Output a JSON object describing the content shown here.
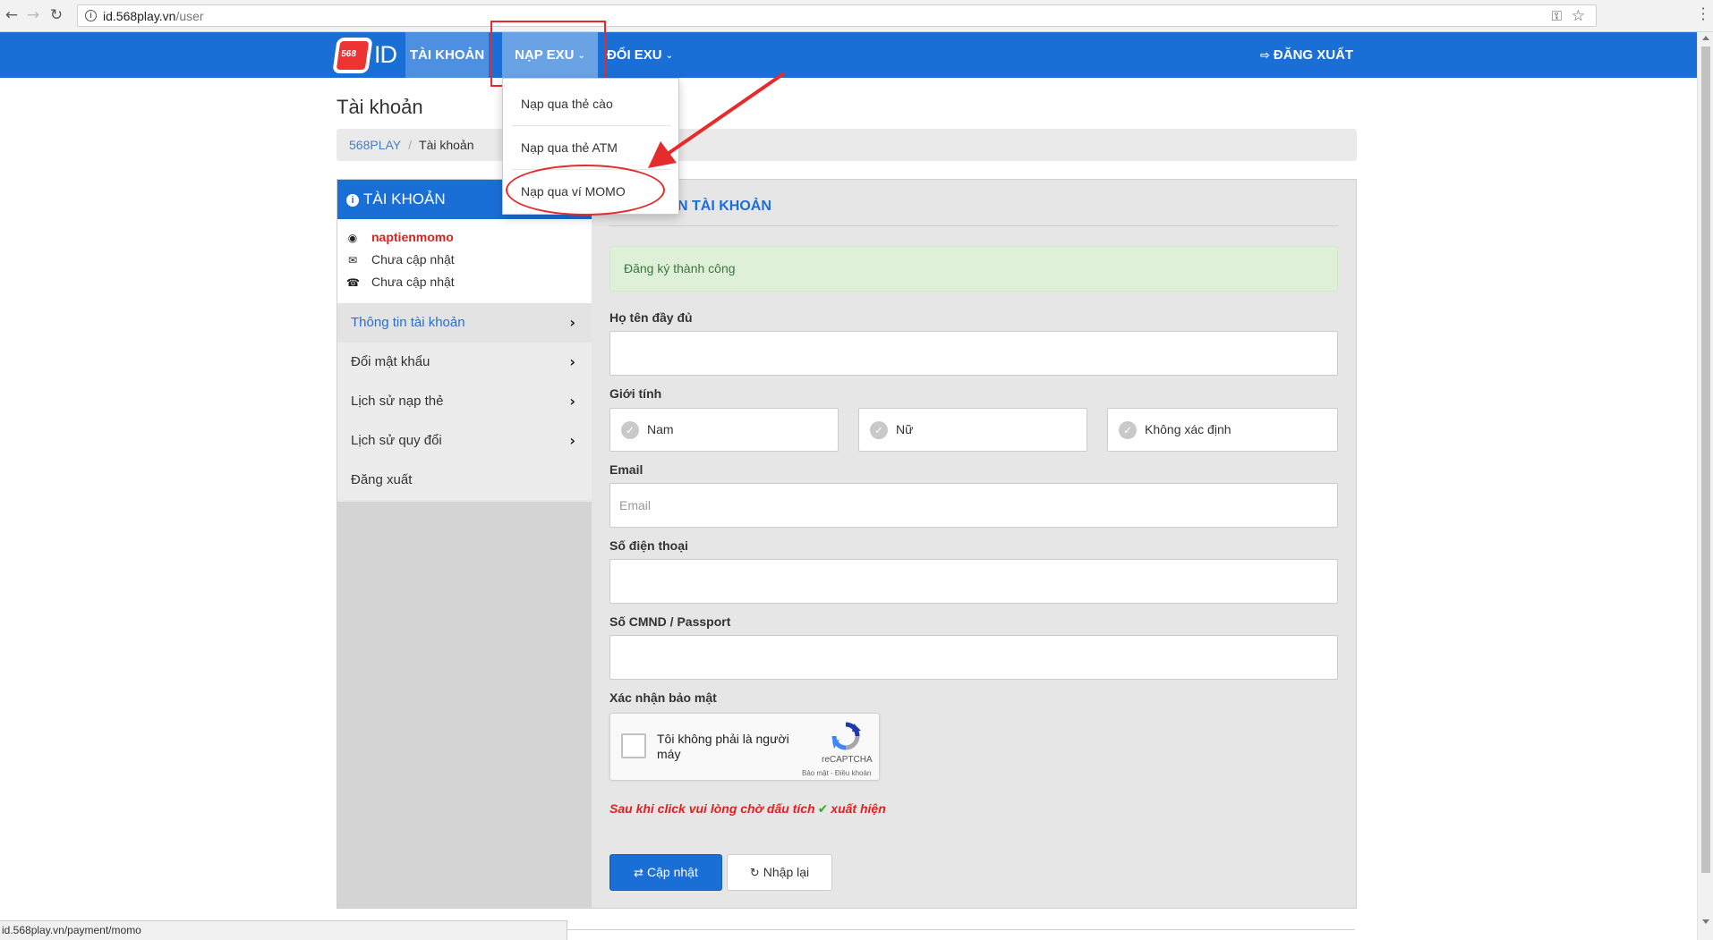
{
  "browser": {
    "url_host": "id.568play.vn",
    "url_path": "/user",
    "back_icon": "arrow-left-icon",
    "forward_icon": "arrow-right-icon",
    "reload_icon": "reload-icon"
  },
  "topbar": {
    "logo_badge": "568",
    "logo_text": "ID",
    "nav": [
      {
        "label": "TÀI KHOẢN"
      },
      {
        "label": "NẠP EXU"
      },
      {
        "label": "ĐỔI EXU"
      }
    ],
    "caret": "⌄",
    "logout_label": "ĐĂNG XUẤT",
    "color": "#1a6fd6"
  },
  "dropdown": {
    "items": [
      {
        "label": "Nạp qua thẻ cào"
      },
      {
        "label": "Nạp qua thẻ ATM"
      },
      {
        "label": "Nạp qua ví MOMO"
      }
    ]
  },
  "page": {
    "title": "Tài khoản",
    "breadcrumb": [
      {
        "label": "568PLAY"
      },
      {
        "label": "Tài khoản"
      }
    ]
  },
  "sidebar": {
    "header": "TÀI KHOẢN",
    "username": "naptienmomo",
    "email": "Chưa cập nhật",
    "phone": "Chưa cập nhật",
    "menu": [
      {
        "label": "Thông tin tài khoản",
        "active": true
      },
      {
        "label": "Đổi mật khẩu"
      },
      {
        "label": "Lịch sử nạp thẻ"
      },
      {
        "label": "Lịch sử quy đổi"
      },
      {
        "label": "Đăng xuất"
      }
    ]
  },
  "form": {
    "section_title": "N TÀI KHOẢN",
    "alert": "Đăng ký thành công",
    "fullname_label": "Họ tên đầy đủ",
    "fullname_value": "",
    "gender_label": "Giới tính",
    "gender_options": [
      {
        "label": "Nam"
      },
      {
        "label": "Nữ"
      },
      {
        "label": "Không xác định"
      }
    ],
    "email_label": "Email",
    "email_placeholder": "Email",
    "phone_label": "Số điện thoại",
    "id_label": "Số CMND / Passport",
    "captcha_label": "Xác nhận bảo mật",
    "captcha_text": "Tôi không phải là người máy",
    "captcha_brand": "reCAPTCHA",
    "captcha_terms": "Bảo mật - Điều khoản",
    "note_before": "Sau khi click vui lòng chờ dấu tích",
    "note_after": "xuất hiện",
    "update_button": "Cập nhật",
    "reset_button": "Nhập lại"
  },
  "statusbar": {
    "text": "id.568play.vn/payment/momo"
  },
  "annotation_color": "#e52b2b"
}
